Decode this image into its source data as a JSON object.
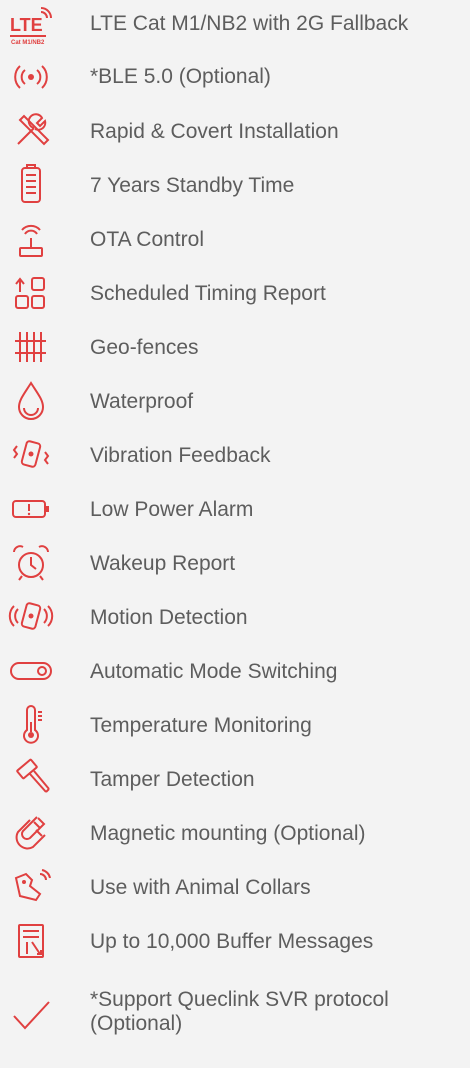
{
  "accent_color": "#e04040",
  "text_color": "#5d5d5d",
  "features": [
    {
      "icon": "lte-icon",
      "label": "LTE Cat M1/NB2 with 2G Fallback",
      "icon_text_main": "LTE",
      "icon_text_sub": "Cat M1/NB2"
    },
    {
      "icon": "bluetooth-signal-icon",
      "label": "*BLE 5.0 (Optional)"
    },
    {
      "icon": "tools-icon",
      "label": "Rapid & Covert Installation"
    },
    {
      "icon": "battery-icon",
      "label": "7 Years Standby Time"
    },
    {
      "icon": "ota-antenna-icon",
      "label": "OTA Control"
    },
    {
      "icon": "scheduled-report-icon",
      "label": "Scheduled Timing Report"
    },
    {
      "icon": "geofence-icon",
      "label": "Geo-fences"
    },
    {
      "icon": "water-drop-icon",
      "label": "Waterproof"
    },
    {
      "icon": "vibration-icon",
      "label": "Vibration Feedback"
    },
    {
      "icon": "low-battery-icon",
      "label": "Low Power Alarm"
    },
    {
      "icon": "alarm-clock-icon",
      "label": "Wakeup Report"
    },
    {
      "icon": "motion-icon",
      "label": "Motion Detection"
    },
    {
      "icon": "toggle-switch-icon",
      "label": "Automatic Mode Switching"
    },
    {
      "icon": "thermometer-icon",
      "label": "Temperature Monitoring"
    },
    {
      "icon": "hammer-icon",
      "label": "Tamper Detection"
    },
    {
      "icon": "magnet-icon",
      "label": "Magnetic mounting (Optional)"
    },
    {
      "icon": "animal-collar-icon",
      "label": "Use with Animal Collars"
    },
    {
      "icon": "buffer-messages-icon",
      "label": "Up to 10,000 Buffer Messages"
    },
    {
      "icon": "checkmark-icon",
      "label": "*Support Queclink SVR protocol (Optional)"
    }
  ]
}
